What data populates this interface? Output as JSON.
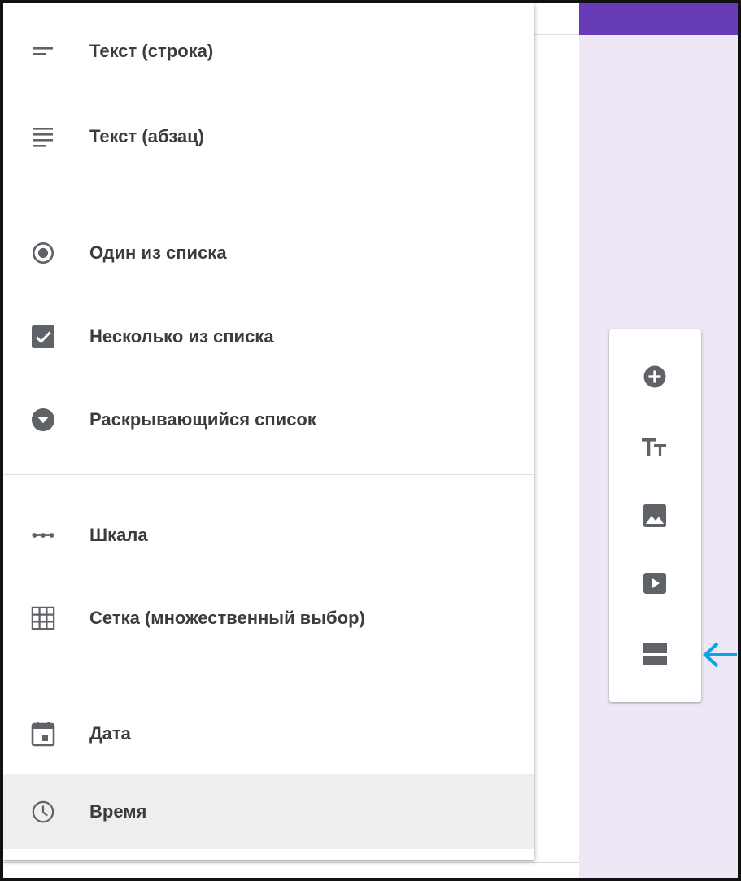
{
  "menu": {
    "items": [
      {
        "label": "Текст (строка)",
        "icon": "short-text-icon"
      },
      {
        "label": "Текст (абзац)",
        "icon": "paragraph-icon"
      },
      {
        "label": "Один из списка",
        "icon": "radio-button-icon"
      },
      {
        "label": "Несколько из списка",
        "icon": "checkbox-icon"
      },
      {
        "label": "Раскрывающийся список",
        "icon": "dropdown-icon"
      },
      {
        "label": "Шкала",
        "icon": "linear-scale-icon"
      },
      {
        "label": "Сетка (множественный выбор)",
        "icon": "grid-icon"
      },
      {
        "label": "Дата",
        "icon": "calendar-icon"
      },
      {
        "label": "Время",
        "icon": "clock-icon"
      }
    ],
    "selected_index": 8
  },
  "toolbar": {
    "tools": [
      "add-question-icon",
      "add-title-icon",
      "add-image-icon",
      "add-video-icon",
      "add-section-icon"
    ]
  },
  "annotation": {
    "arrow_target": "add-section-icon"
  },
  "colors": {
    "header_purple": "#673ab7",
    "background_lavender": "#ede7f6",
    "icon_gray": "#5f6368",
    "selected_bg": "#eeeeee",
    "arrow_blue": "#0aa3e8",
    "text": "#3c3c3c"
  }
}
